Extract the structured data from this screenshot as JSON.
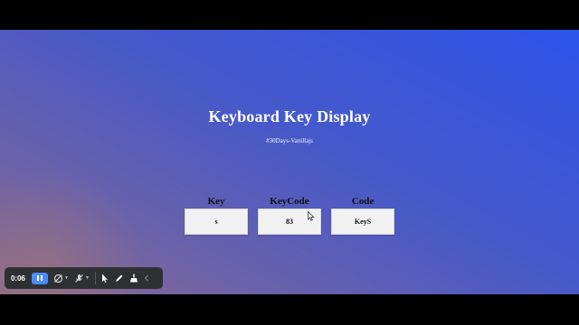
{
  "page": {
    "title": "Keyboard Key Display",
    "subtitle": "#30Days-Vanillajs"
  },
  "keys": [
    {
      "label": "Key",
      "value": "s"
    },
    {
      "label": "KeyCode",
      "value": "83"
    },
    {
      "label": "Code",
      "value": "KeyS"
    }
  ],
  "recorder": {
    "time": "0:06",
    "controls": [
      "pause-icon",
      "camera-off-icon",
      "mic-off-icon",
      "pointer-icon",
      "pen-icon",
      "broom-icon",
      "collapse-icon"
    ]
  },
  "colors": {
    "gradient_start": "#2d54ea",
    "gradient_end": "#8c6a8e",
    "box_background": "#f1f1f1",
    "toolbar_background": "#2f3033",
    "pause_button": "#4a8ef5"
  }
}
